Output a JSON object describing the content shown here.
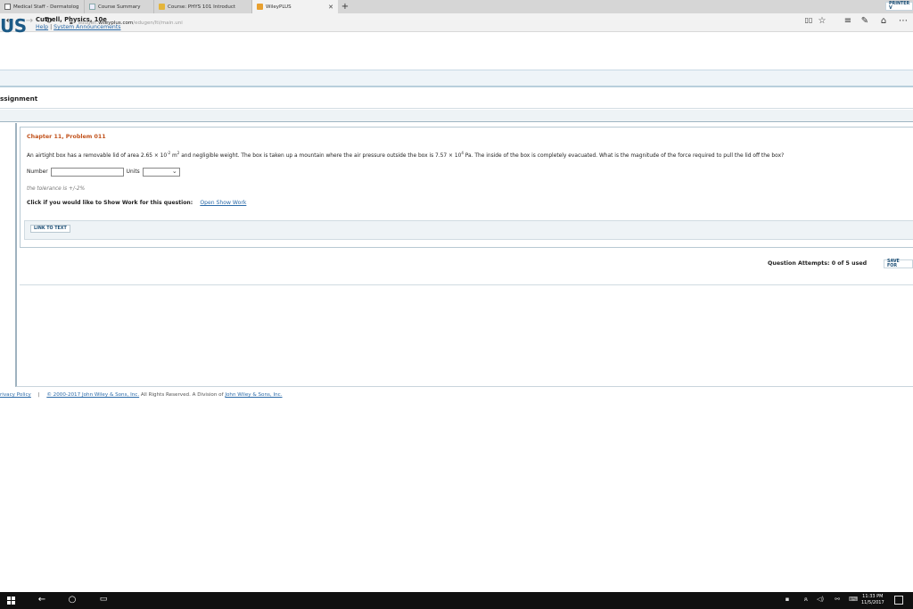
{
  "browser": {
    "tabs": [
      {
        "label": "Medical Staff - Dermatolog",
        "icon": "document-icon"
      },
      {
        "label": "Course Summary",
        "icon": "page-icon"
      },
      {
        "label": "Course: PHYS 101 Introduct",
        "icon": "folder-icon"
      },
      {
        "label": "WileyPLUS",
        "icon": "wiley-icon",
        "active": true
      }
    ],
    "close_glyph": "✕",
    "new_tab_glyph": "+",
    "url": {
      "prefix": "edugen.",
      "domain": "wileyplus.com",
      "path": "/edugen/lti/main.uni"
    }
  },
  "header": {
    "logo_text": "US",
    "book_title": "Cutnell, Physics, 10e",
    "help_link": "Help",
    "separator": "|",
    "announcements_link": "System Announcements"
  },
  "section_title": "ssignment",
  "printer_button": "PRINTER V",
  "problem": {
    "title": "Chapter 11, Problem 011",
    "text_1": "An airtight box has a removable lid of area 2.65 × 10",
    "exp_1": "-2",
    "text_2": " m",
    "exp_2": "2",
    "text_3": " and negligible weight. The box is taken up a mountain where the air pressure outside the box is 7.57 × 10",
    "exp_3": "4",
    "text_4": " Pa. The inside of the box is completely evacuated. What is the magnitude of the force required to pull the lid off the box?",
    "number_label": "Number",
    "number_value": "",
    "units_label": "Units",
    "tolerance": "the tolerance is +/-2%",
    "show_work_prompt": "Click if you would like to Show Work for this question:",
    "show_work_link": "Open Show Work",
    "link_to_text": "LINK TO TEXT"
  },
  "attempts": "Question Attempts: 0 of 5 used",
  "save_button": "SAVE FOR",
  "footer": {
    "privacy": "rivacy Policy",
    "sep": "|",
    "copyright_link": "© 2000-2017 John Wiley & Sons, Inc.",
    "rights": " All Rights Reserved. A Division of ",
    "company_link": "John Wiley & Sons, Inc."
  },
  "taskbar": {
    "time": "11:33 PM",
    "date": "11/5/2017"
  }
}
